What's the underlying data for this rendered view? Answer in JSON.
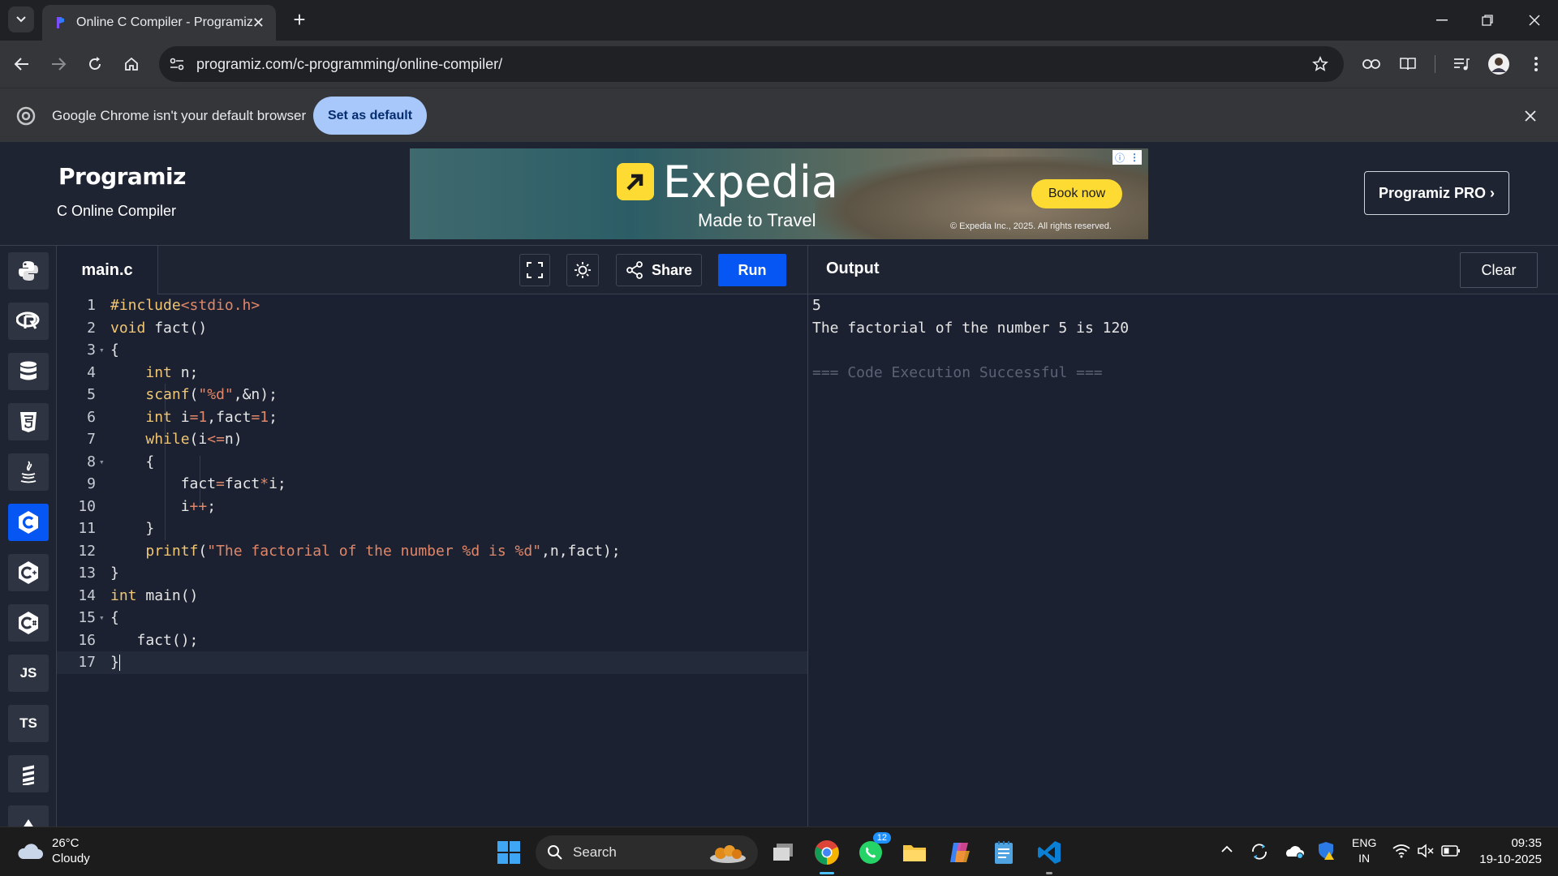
{
  "browser": {
    "tab_title": "Online C Compiler - Programiz",
    "url": "programiz.com/c-programming/online-compiler/",
    "infobar_message": "Google Chrome isn't your default browser",
    "set_default_label": "Set as default"
  },
  "site": {
    "logo": "Programiz",
    "subtitle": "C Online Compiler",
    "pro_label": "Programiz PRO ›",
    "ad": {
      "brand": "Expedia",
      "tagline": "Made to Travel",
      "cta": "Book now",
      "copyright": "© Expedia Inc., 2025. All rights reserved."
    }
  },
  "languages": [
    {
      "name": "python-icon"
    },
    {
      "name": "r-icon"
    },
    {
      "name": "sql-icon"
    },
    {
      "name": "html-icon"
    },
    {
      "name": "java-icon"
    },
    {
      "name": "c-icon",
      "active": true
    },
    {
      "name": "cpp-icon"
    },
    {
      "name": "csharp-icon"
    },
    {
      "name": "js-icon",
      "label": "JS"
    },
    {
      "name": "ts-icon",
      "label": "TS"
    },
    {
      "name": "swift-icon"
    },
    {
      "name": "go-icon"
    }
  ],
  "editor": {
    "filename": "main.c",
    "share_label": "Share",
    "run_label": "Run",
    "lines": [
      "1",
      "2",
      "3",
      "4",
      "5",
      "6",
      "7",
      "8",
      "9",
      "10",
      "11",
      "12",
      "13",
      "14",
      "15",
      "16",
      "17"
    ]
  },
  "output": {
    "title": "Output",
    "clear_label": "Clear",
    "lines": [
      "5",
      "The factorial of the number 5 is 120",
      "",
      "=== Code Execution Successful ==="
    ]
  },
  "taskbar": {
    "temperature": "26°C",
    "weather": "Cloudy",
    "search_label": "Search",
    "whatsapp_badge": "12",
    "lang_top": "ENG",
    "lang_bottom": "IN",
    "time": "09:35",
    "date": "19-10-2025"
  },
  "colors": {
    "accent": "#0556f3",
    "editor_bg": "#1b2130",
    "keyword": "#f0c674",
    "string": "#e0876a"
  }
}
